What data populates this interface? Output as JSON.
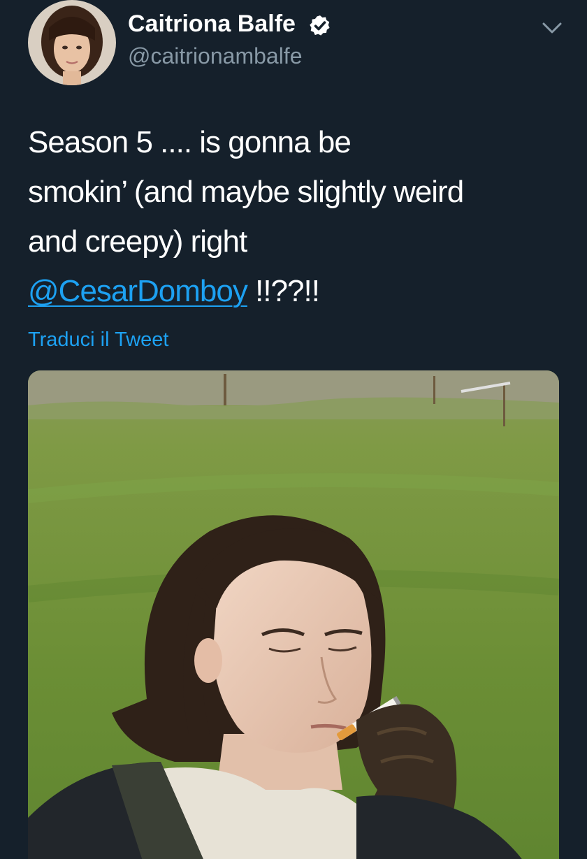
{
  "author": {
    "display_name": "Caitriona Balfe",
    "handle": "@caitrionambalfe",
    "verified": true,
    "avatar_icon": "profile-photo"
  },
  "menu": {
    "icon": "chevron-down-icon"
  },
  "tweet": {
    "line_1": "Season 5 .... is gonna be",
    "line_2": "smokin’ (and maybe slightly weird",
    "line_3": "and creepy) right",
    "mention": "@CesarDomboy",
    "line_4_suffix": " !!??!!"
  },
  "translate_link": "Traduci il Tweet",
  "media": {
    "type": "photo",
    "description_icon": "photo-man-smoking-in-field"
  },
  "colors": {
    "background": "#15202b",
    "accent": "#1da1f2",
    "secondary_text": "#8899a6"
  }
}
